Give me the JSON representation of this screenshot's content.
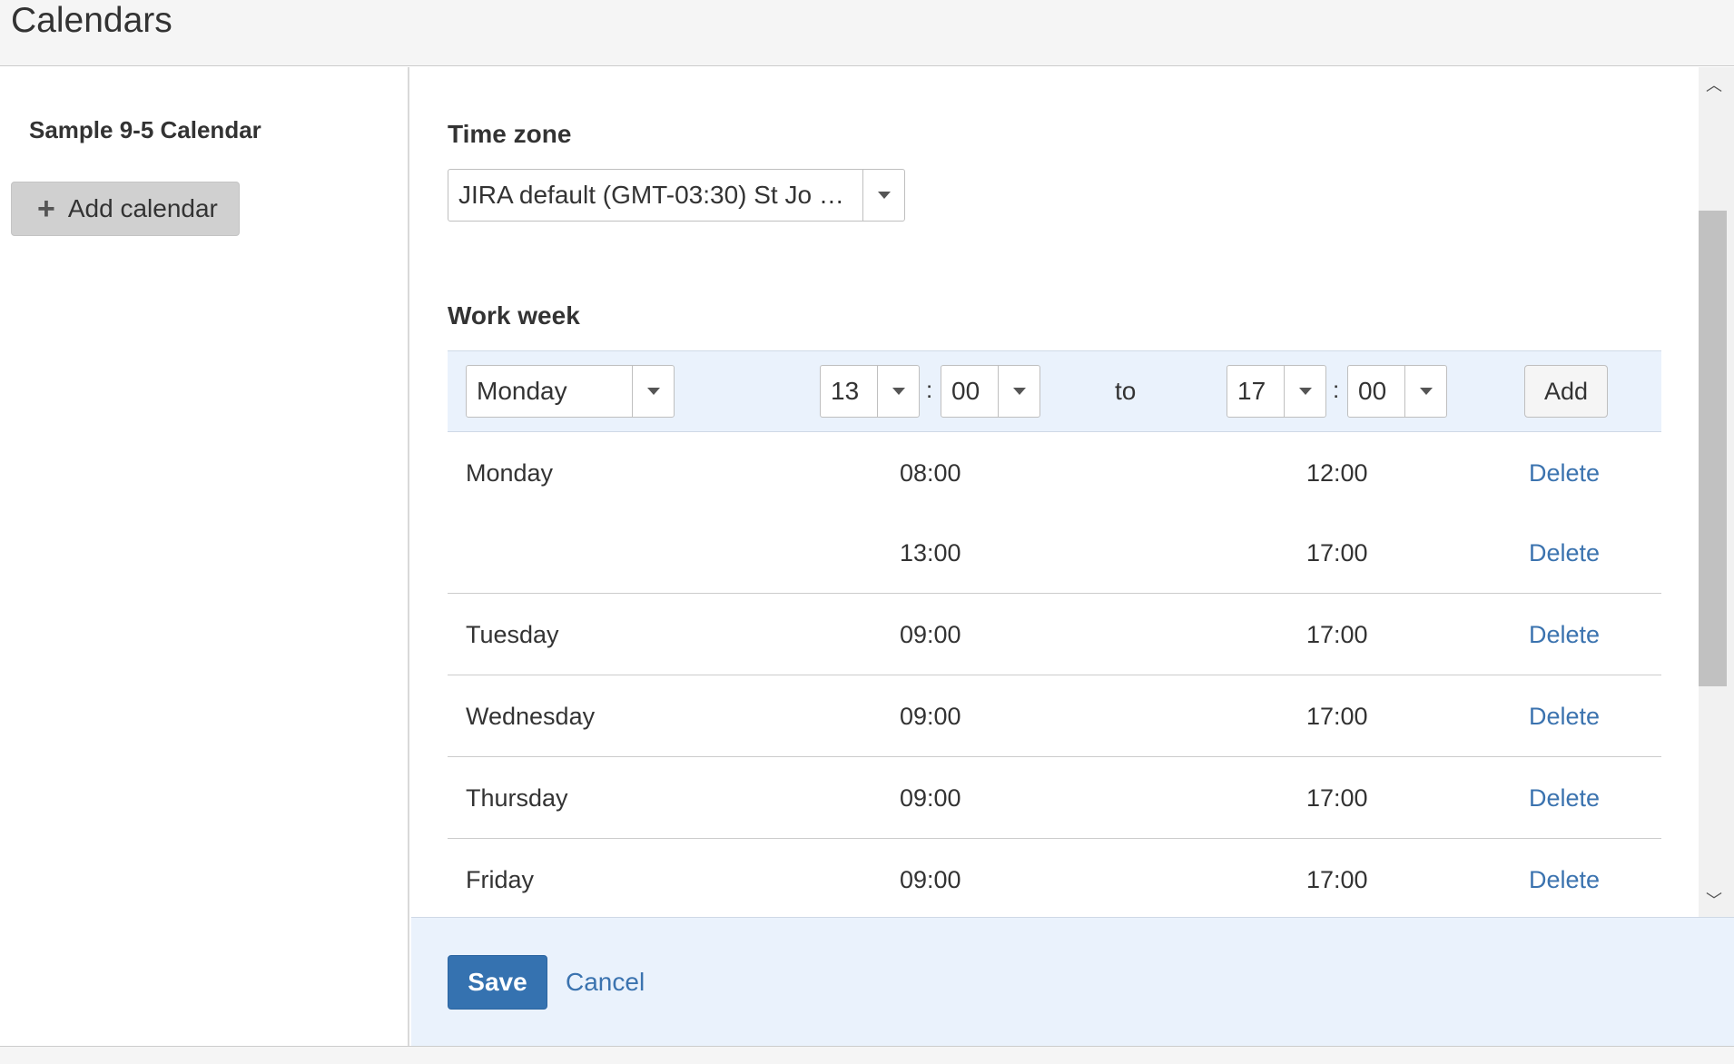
{
  "header": {
    "title": "Calendars"
  },
  "sidebar": {
    "calendar_name": "Sample 9-5 Calendar",
    "add_calendar_label": "Add calendar"
  },
  "timezone": {
    "label": "Time zone",
    "value": "JIRA default (GMT-03:30) St Jo …"
  },
  "workweek": {
    "label": "Work week",
    "entry": {
      "day": "Monday",
      "from_hour": "13",
      "from_min": "00",
      "to_label": "to",
      "to_hour": "17",
      "to_min": "00",
      "add_label": "Add",
      "separator": ":"
    },
    "rows": [
      {
        "day": "Monday",
        "from": "08:00",
        "to": "12:00",
        "action": "Delete"
      },
      {
        "day": "",
        "from": "13:00",
        "to": "17:00",
        "action": "Delete"
      },
      {
        "day": "Tuesday",
        "from": "09:00",
        "to": "17:00",
        "action": "Delete"
      },
      {
        "day": "Wednesday",
        "from": "09:00",
        "to": "17:00",
        "action": "Delete"
      },
      {
        "day": "Thursday",
        "from": "09:00",
        "to": "17:00",
        "action": "Delete"
      },
      {
        "day": "Friday",
        "from": "09:00",
        "to": "17:00",
        "action": "Delete"
      }
    ]
  },
  "footer": {
    "save_label": "Save",
    "cancel_label": "Cancel"
  },
  "colors": {
    "accent": "#3572b0",
    "link": "#3b73af",
    "panel": "#eaf2fc"
  },
  "icons": {
    "add": "plus-icon",
    "dropdown": "chevron-down-icon",
    "scroll_up": "arrow-up-icon",
    "scroll_down": "arrow-down-icon"
  }
}
